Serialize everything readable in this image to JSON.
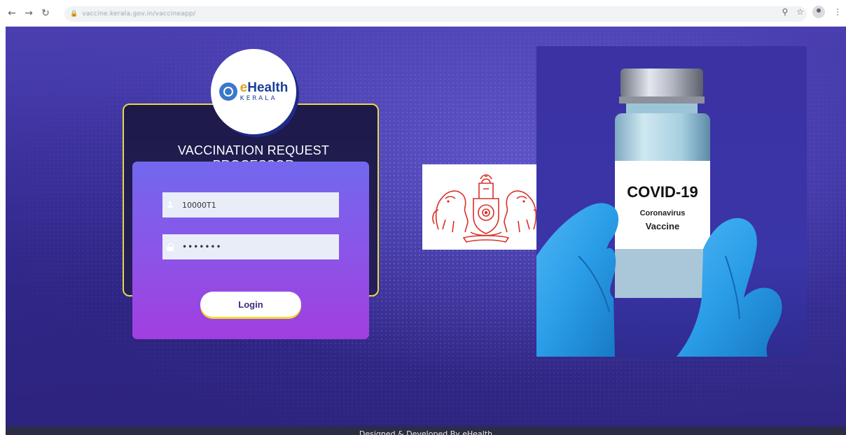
{
  "browser": {
    "url": "vaccine.kerala.gov.in/vaccineapp/"
  },
  "login_panel": {
    "title": "VACCINATION REQUEST PROCESSOR",
    "logo_brand_e": "e",
    "logo_brand_rest": "Health",
    "logo_state": "KERALA",
    "username_value": "10000T1",
    "password_value": "•••••••",
    "login_label": "Login"
  },
  "vaccine_image": {
    "label_main": "COVID-19",
    "label_sub1": "Coronavirus",
    "label_sub2": "Vaccine"
  },
  "footer": {
    "text": "Designed & Developed By eHealth"
  },
  "colors": {
    "page_bg": "#3d33a0",
    "frame_border": "#e8d84a",
    "card_top": "#7268ee",
    "card_bottom": "#a23ee0",
    "emblem_red": "#d8302a",
    "glove_blue": "#2a9de8",
    "footer_bg": "#2b2d44"
  }
}
